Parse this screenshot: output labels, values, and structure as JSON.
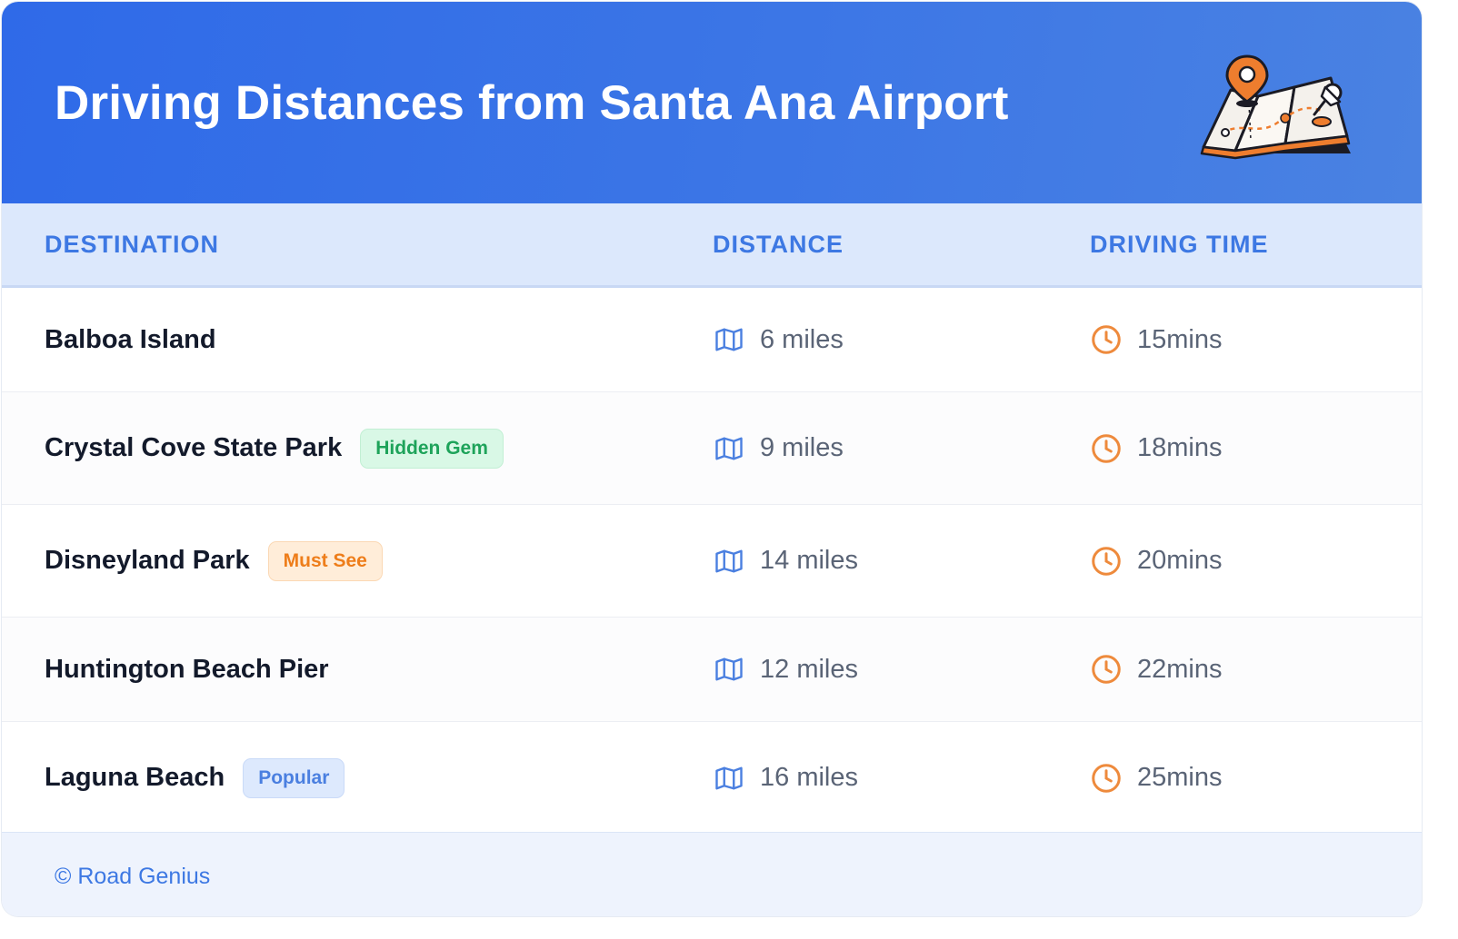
{
  "header": {
    "title": "Driving Distances from Santa Ana Airport"
  },
  "table": {
    "columns": [
      "DESTINATION",
      "DISTANCE",
      "DRIVING TIME"
    ],
    "rows": [
      {
        "destination": "Balboa Island",
        "badge": "",
        "distance": "6 miles",
        "time": "15mins"
      },
      {
        "destination": "Crystal Cove State Park",
        "badge": "Hidden Gem",
        "distance": "9 miles",
        "time": "18mins"
      },
      {
        "destination": "Disneyland Park",
        "badge": "Must See",
        "distance": "14 miles",
        "time": "20mins"
      },
      {
        "destination": "Huntington Beach Pier",
        "badge": "",
        "distance": "12 miles",
        "time": "22mins"
      },
      {
        "destination": "Laguna Beach",
        "badge": "Popular",
        "distance": "16 miles",
        "time": "25mins"
      }
    ]
  },
  "icons": {
    "distance": "map-icon",
    "time": "clock-icon",
    "header": "map-with-pin-illustration"
  },
  "colors": {
    "header_start": "#2f6ae8",
    "header_end": "#4a82e2",
    "accent_blue": "#3d78e3",
    "accent_orange": "#ee8a3c",
    "badge_green": "#1ea35a",
    "badge_orange": "#ee7d1a",
    "badge_blue": "#4a7fe0"
  },
  "footer": {
    "credit": "© Road Genius"
  }
}
